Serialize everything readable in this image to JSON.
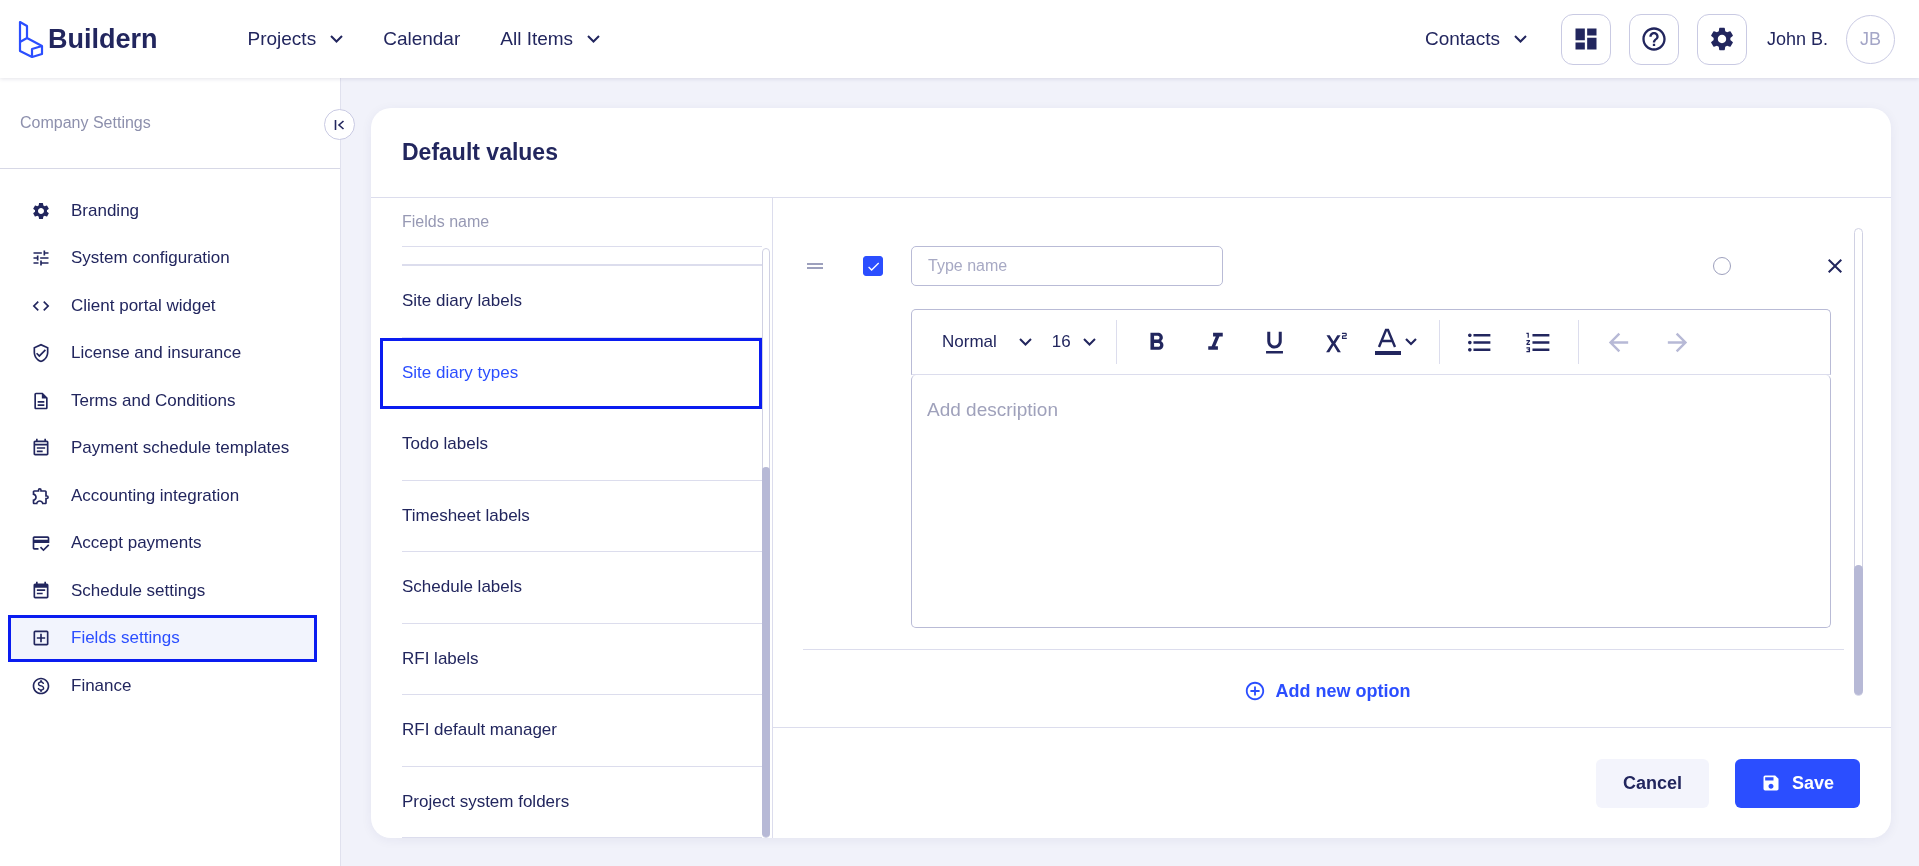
{
  "header": {
    "logo": "Buildern",
    "nav": [
      {
        "label": "Projects",
        "dropdown": true
      },
      {
        "label": "Calendar",
        "dropdown": false
      },
      {
        "label": "All Items",
        "dropdown": true
      }
    ],
    "contacts": {
      "label": "Contacts",
      "dropdown": true
    },
    "user": {
      "name": "John B.",
      "initials": "JB"
    }
  },
  "sidebar": {
    "title": "Company Settings",
    "items": [
      {
        "label": "Branding",
        "selected": false
      },
      {
        "label": "System configuration",
        "selected": false
      },
      {
        "label": "Client portal widget",
        "selected": false
      },
      {
        "label": "License and insurance",
        "selected": false
      },
      {
        "label": "Terms and Conditions",
        "selected": false
      },
      {
        "label": "Payment schedule templates",
        "selected": false
      },
      {
        "label": "Accounting integration",
        "selected": false
      },
      {
        "label": "Accept payments",
        "selected": false
      },
      {
        "label": "Schedule settings",
        "selected": false
      },
      {
        "label": "Fields settings",
        "selected": true
      },
      {
        "label": "Finance",
        "selected": false
      }
    ]
  },
  "card": {
    "title": "Default values",
    "list_header": "Fields name",
    "fields": [
      {
        "label": "Site diary labels",
        "selected": false
      },
      {
        "label": "Site diary types",
        "selected": true
      },
      {
        "label": "Todo labels",
        "selected": false
      },
      {
        "label": "Timesheet labels",
        "selected": false
      },
      {
        "label": "Schedule labels",
        "selected": false
      },
      {
        "label": "RFI labels",
        "selected": false
      },
      {
        "label": "RFI default manager",
        "selected": false
      },
      {
        "label": "Project system folders",
        "selected": false
      }
    ],
    "option": {
      "checked": true,
      "name_placeholder": "Type name",
      "default_selected": false,
      "text_style": "Normal",
      "font_size": "16",
      "description_placeholder": "Add description",
      "undo_disabled": true,
      "redo_disabled": true
    },
    "add_option": "Add new option",
    "cancel": "Cancel",
    "save": "Save"
  }
}
